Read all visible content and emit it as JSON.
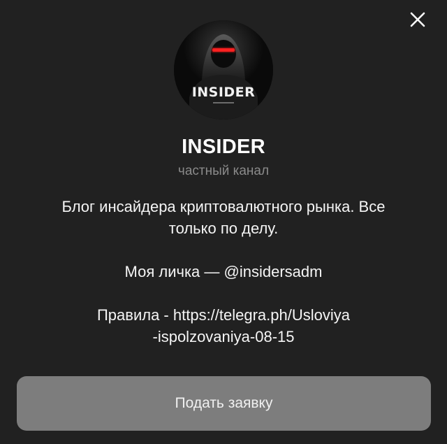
{
  "dialog": {
    "close_icon": "close-icon"
  },
  "channel": {
    "avatar_icon": "channel-avatar",
    "avatar_logo_text": "INSIDER",
    "title": "INSIDER",
    "type": "частный канал"
  },
  "description": {
    "line_1": "Блог инсайдера криптовалютного рынка. Все",
    "line_2": "только по делу.",
    "line_3": "Моя личка — @insidersadm",
    "line_4": "Правила - https://telegra.ph/Usloviya",
    "line_5": "-ispolzovaniya-08-15"
  },
  "actions": {
    "apply_label": "Подать заявку"
  },
  "colors": {
    "background": "#212121",
    "secondary_text": "#8a8a8a",
    "button_bg": "#7d7d7d",
    "visor_red": "#ff2020"
  }
}
